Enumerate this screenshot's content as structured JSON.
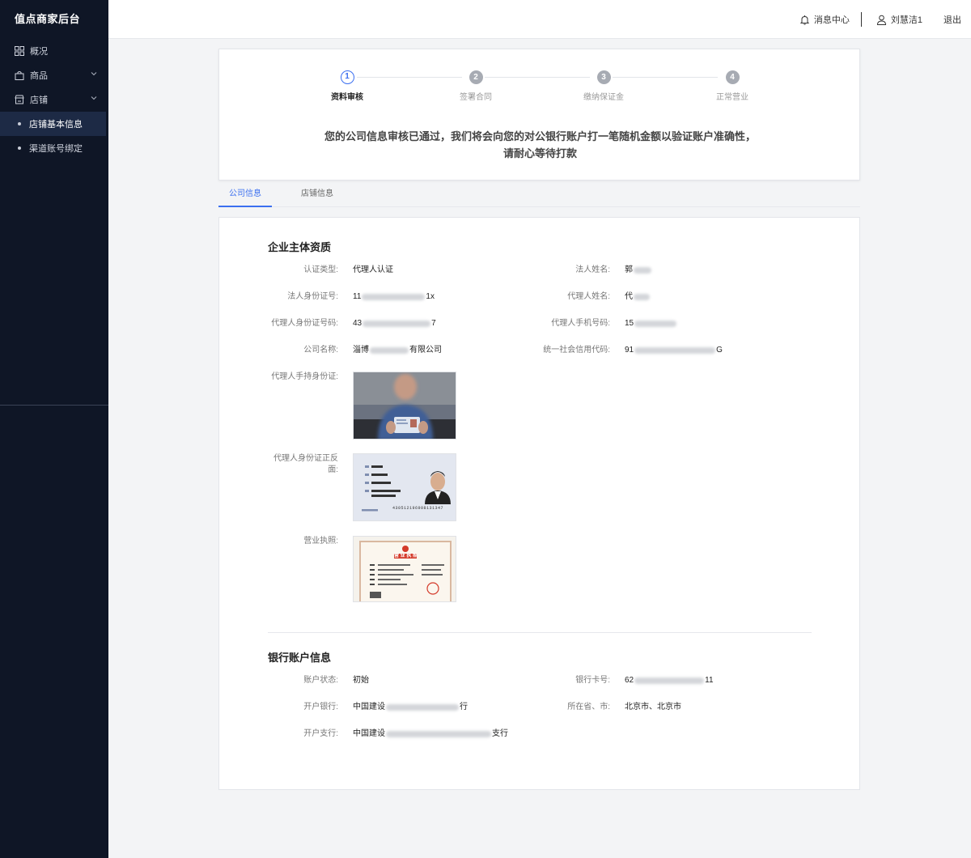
{
  "sidebar": {
    "brand": "值点商家后台",
    "items": [
      {
        "label": "概况"
      },
      {
        "label": "商品"
      },
      {
        "label": "店铺"
      }
    ],
    "subitems": [
      {
        "label": "店铺基本信息"
      },
      {
        "label": "渠道账号绑定"
      }
    ]
  },
  "header": {
    "messages": "消息中心",
    "user": "刘慧洁1",
    "logout": "退出"
  },
  "steps": [
    {
      "num": "1",
      "label": "资料审核"
    },
    {
      "num": "2",
      "label": "签署合同"
    },
    {
      "num": "3",
      "label": "缴纳保证金"
    },
    {
      "num": "4",
      "label": "正常营业"
    }
  ],
  "notice": {
    "line1": "您的公司信息审核已通过，我们将会向您的对公银行账户打一笔随机金额以验证账户准确性，",
    "line2": "请耐心等待打款"
  },
  "tabs": [
    {
      "label": "公司信息"
    },
    {
      "label": "店铺信息"
    }
  ],
  "company": {
    "title": "企业主体资质",
    "cert_type": {
      "label": "认证类型:",
      "value": "代理人认证"
    },
    "legal_name": {
      "label": "法人姓名:",
      "prefix": "郭"
    },
    "legal_id": {
      "label": "法人身份证号:",
      "prefix": "11",
      "suffix": "1x"
    },
    "agent_name": {
      "label": "代理人姓名:",
      "prefix": "代"
    },
    "agent_id": {
      "label": "代理人身份证号码:",
      "prefix": "43",
      "suffix": "7"
    },
    "agent_phone": {
      "label": "代理人手机号码:",
      "prefix": "15"
    },
    "company_name": {
      "label": "公司名称:",
      "prefix": "淄博",
      "suffix": "有限公司"
    },
    "credit_code": {
      "label": "统一社会信用代码:",
      "prefix": "91",
      "suffix": "G"
    },
    "photo_handheld": {
      "label": "代理人手持身份证:"
    },
    "photo_id": {
      "label_line1": "代理人身份证正反",
      "label_line2": "面:",
      "id_number": "430512196908131347"
    },
    "photo_license": {
      "label": "营业执照:",
      "license_title": "营 业 执 照"
    }
  },
  "bank": {
    "title": "银行账户信息",
    "status": {
      "label": "账户状态:",
      "value": "初始"
    },
    "card_no": {
      "label": "银行卡号:",
      "prefix": "62",
      "suffix": "11"
    },
    "bank_name": {
      "label": "开户银行:",
      "prefix": "中国建设",
      "suffix": "行"
    },
    "region": {
      "label": "所在省、市:",
      "value": "北京市、北京市"
    },
    "branch": {
      "label": "开户支行:",
      "prefix": "中国建设",
      "suffix": "支行"
    }
  },
  "colors": {
    "sidebar_bg": "#0f1626",
    "accent": "#3b6ff0",
    "page_bg": "#f3f4f6"
  }
}
